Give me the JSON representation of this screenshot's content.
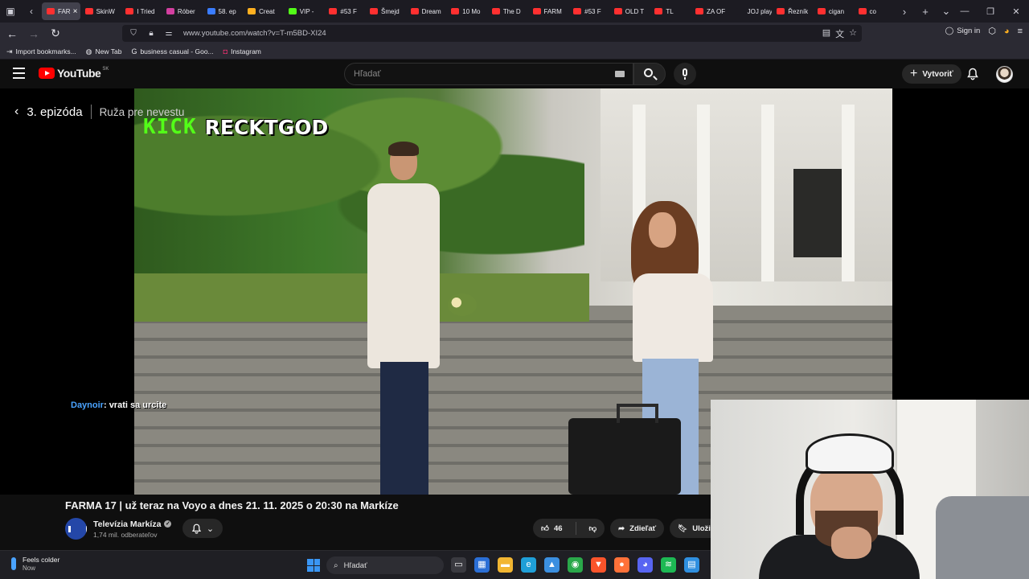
{
  "browser": {
    "tabs": [
      {
        "label": "FAR",
        "color": "#ff3030",
        "active": true
      },
      {
        "label": "SkinW",
        "color": "#ff3030"
      },
      {
        "label": "I Tried",
        "color": "#ff3030"
      },
      {
        "label": "Róber",
        "color": "#d33fa0"
      },
      {
        "label": "58. ep",
        "color": "#3a7cff"
      },
      {
        "label": "Creat",
        "color": "#ffb020"
      },
      {
        "label": "VIP -",
        "color": "#53fc18"
      },
      {
        "label": "#53 F",
        "color": "#ff3030"
      },
      {
        "label": "Šmejd",
        "color": "#ff3030"
      },
      {
        "label": "Dream",
        "color": "#ff3030"
      },
      {
        "label": "10 Mo",
        "color": "#ff3030"
      },
      {
        "label": "The D",
        "color": "#ff3030"
      },
      {
        "label": "FARM",
        "color": "#ff3030"
      },
      {
        "label": "#53 F",
        "color": "#ff3030"
      },
      {
        "label": "OLD T",
        "color": "#ff3030"
      },
      {
        "label": "TL",
        "color": "#ff3030"
      },
      {
        "label": "ZA OF",
        "color": "#ff3030"
      },
      {
        "label": "JOJ play",
        "color": "#1c1b22"
      },
      {
        "label": "Řezník",
        "color": "#ff3030"
      },
      {
        "label": "cigan",
        "color": "#ff3030"
      },
      {
        "label": "co",
        "color": "#ff3030"
      }
    ],
    "url": "www.youtube.com/watch?v=T-m5BD-XI24",
    "sign_in": "Sign in",
    "bookmarks": [
      {
        "label": "Import bookmarks...",
        "icon": "bookmark-import-icon"
      },
      {
        "label": "New Tab",
        "icon": "globe-icon"
      },
      {
        "label": "business casual - Goo...",
        "icon": "google-icon"
      },
      {
        "label": "Instagram",
        "icon": "instagram-icon"
      }
    ]
  },
  "youtube": {
    "logo_text": "YouTube",
    "country": "SK",
    "search_placeholder": "Hľadať",
    "create_label": "Vytvoriť"
  },
  "player": {
    "episode_label": "3. epizóda",
    "show_label": "Ruža pre nevestu",
    "overlay_kick": "KICK",
    "overlay_name": "RECKTGOD",
    "chat_user": "Daynoir",
    "chat_message": ": vrati sa urcite"
  },
  "video": {
    "title": "FARMA 17 | už teraz na Voyo a dnes 21. 11. 2025 o 20:30 na Markíze",
    "channel_name": "Televízia Markíza",
    "subscribers": "1,74 mil. odberateľov",
    "likes": "46",
    "share_label": "Zdieľať",
    "save_label": "Uložiť"
  },
  "taskbar": {
    "weather_title": "Feels colder",
    "weather_sub": "Now",
    "search_label": "Hľadať",
    "apps": [
      {
        "name": "task-view-icon",
        "color": "#3a3a40",
        "glyph": "▭"
      },
      {
        "name": "store-icon",
        "color": "#2b6fd6",
        "glyph": "▦"
      },
      {
        "name": "file-explorer-icon",
        "color": "#f2b632",
        "glyph": "▬"
      },
      {
        "name": "edge-icon",
        "color": "#1f9fd8",
        "glyph": "e"
      },
      {
        "name": "photos-icon",
        "color": "#3b8fe0",
        "glyph": "▲"
      },
      {
        "name": "chrome-icon",
        "color": "#2aa84a",
        "glyph": "◉"
      },
      {
        "name": "brave-icon",
        "color": "#fb542b",
        "glyph": "▼"
      },
      {
        "name": "firefox-icon",
        "color": "#ff7139",
        "glyph": "●"
      },
      {
        "name": "discord-icon",
        "color": "#5865f2",
        "glyph": "◕"
      },
      {
        "name": "spotify-icon",
        "color": "#1db954",
        "glyph": "≋"
      },
      {
        "name": "notepad-icon",
        "color": "#2f8fe0",
        "glyph": "▤"
      }
    ]
  }
}
